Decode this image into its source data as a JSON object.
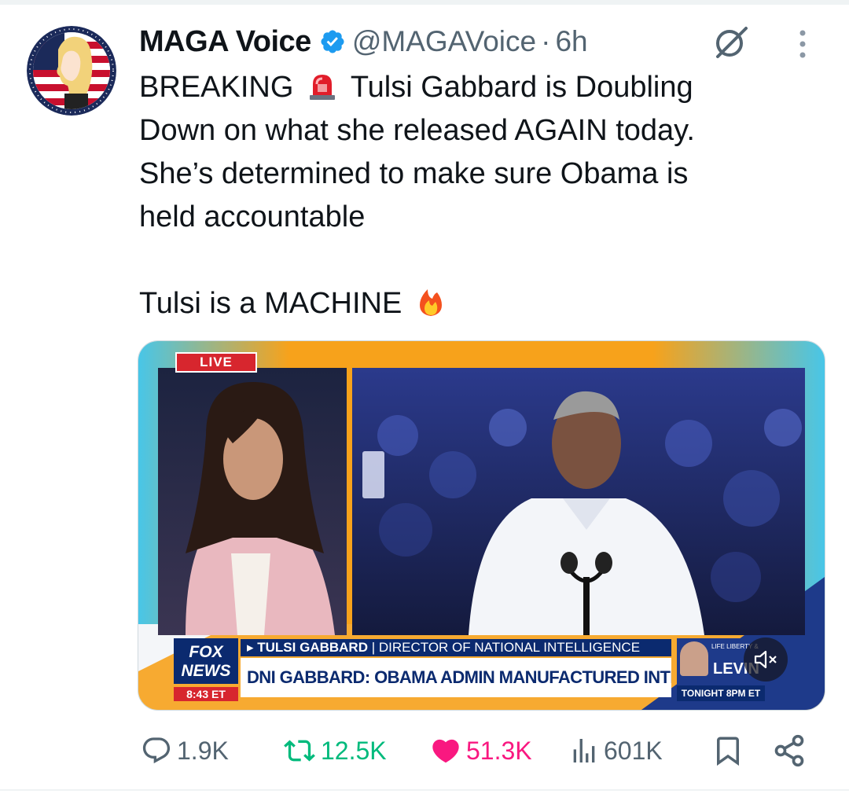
{
  "tweet": {
    "author": {
      "display_name": "MAGA Voice",
      "handle": "@MAGAVoice",
      "separator": "·",
      "time": "6h",
      "verified": true
    },
    "text_lines": [
      "BREAKING",
      "Tulsi Gabbard is Doubling",
      "Down on what she released AGAIN today.",
      "She’s determined to make sure Obama is",
      "held accountable",
      "Tulsi is a MACHINE"
    ],
    "emojis": [
      "police-light-emoji",
      "fire-emoji"
    ]
  },
  "media": {
    "live_badge": "LIVE",
    "network": {
      "line1": "FOX",
      "line2": "NEWS"
    },
    "clock": "8:43 ET",
    "lower_third": {
      "name": "TULSI GABBARD",
      "title": "DIRECTOR OF NATIONAL INTELLIGENCE",
      "headline": "DNI GABBARD: OBAMA ADMIN MANUFACTURED INTELLIGENCE"
    },
    "promo": {
      "show": "LEVIN",
      "show_small": "LIFE LIBERTY &",
      "time": "TONIGHT 8PM ET"
    }
  },
  "actions": {
    "replies": "1.9K",
    "reposts": "12.5K",
    "likes": "51.3K",
    "views": "601K"
  },
  "colors": {
    "text": "#0f1419",
    "secondary": "#536471",
    "verified_blue": "#1d9bf0",
    "repost_green": "#00ba7c",
    "like_pink": "#f91880",
    "fox_orange": "#f7a21b",
    "fox_navy": "#0b2a6f"
  }
}
